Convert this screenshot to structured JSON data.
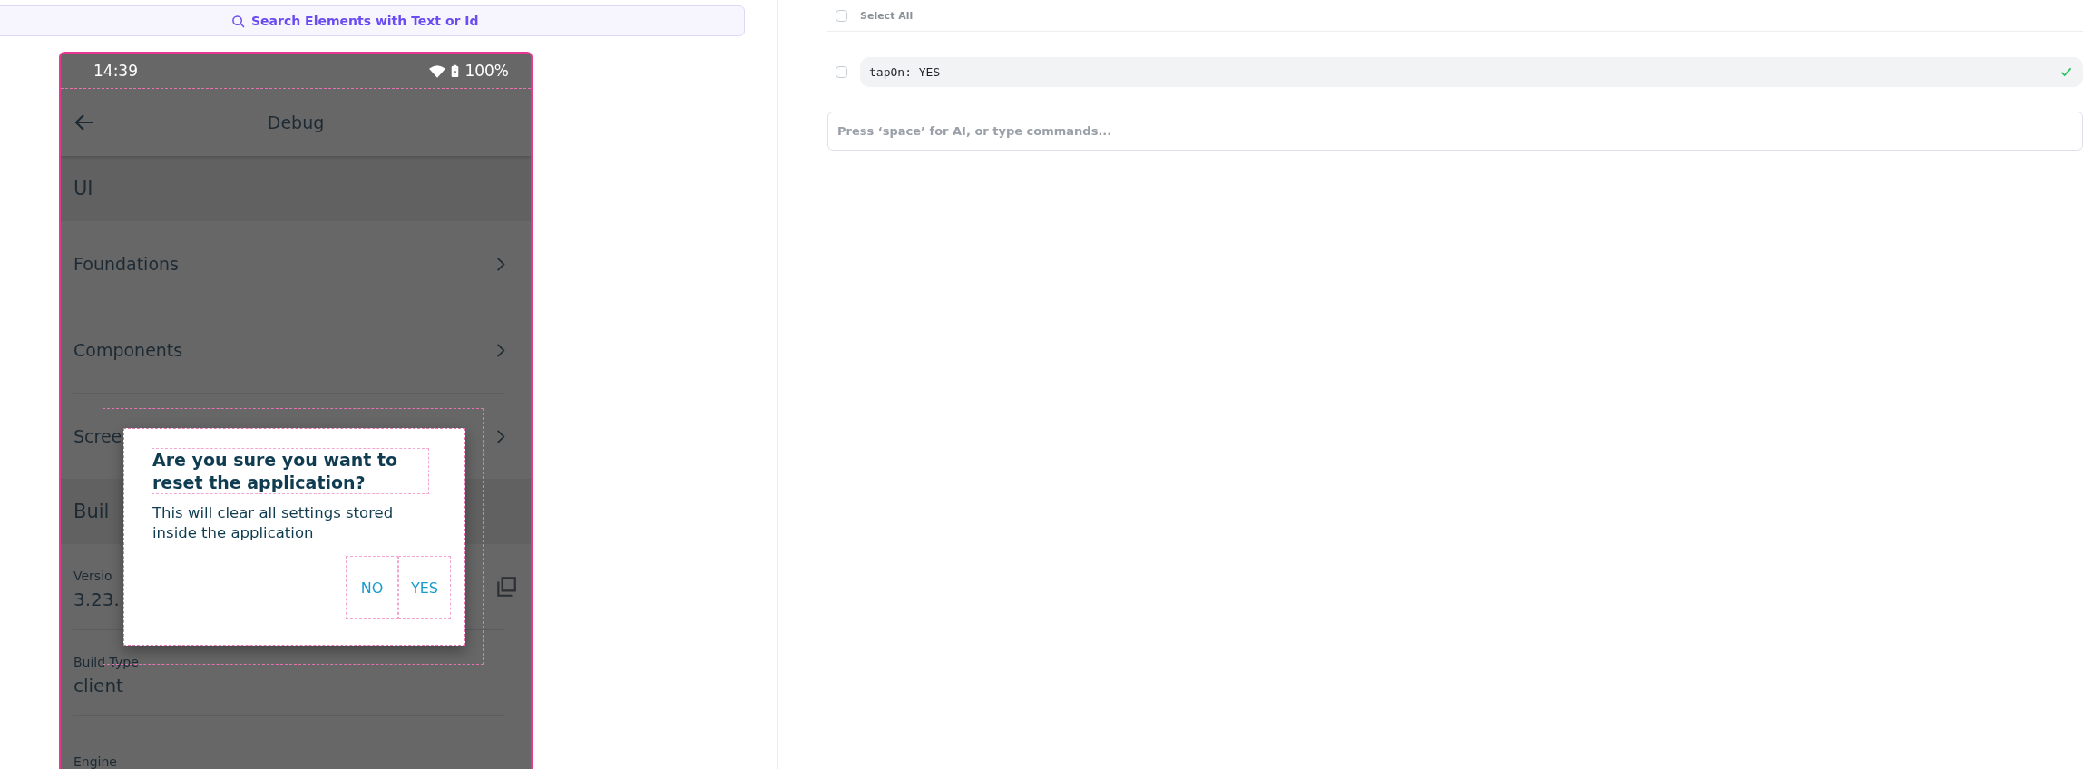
{
  "search": {
    "placeholder": "Search Elements with Text or Id"
  },
  "device": {
    "status_bar": {
      "time": "14:39",
      "battery": "100%"
    },
    "app_bar": {
      "title": "Debug"
    },
    "sections": [
      {
        "header": "UI",
        "rows": [
          {
            "kind": "nav",
            "label": "Foundations"
          },
          {
            "kind": "nav",
            "label": "Components"
          },
          {
            "kind": "nav",
            "label": "Scree"
          }
        ]
      },
      {
        "header": "Buil",
        "rows": [
          {
            "kind": "info",
            "label": "Versio",
            "value": "3.23.",
            "copy": true
          },
          {
            "kind": "info",
            "label": "Build Type",
            "value": "client"
          },
          {
            "kind": "info",
            "label": "Engine"
          }
        ]
      }
    ],
    "dialog": {
      "title": "Are you sure you want to reset the application?",
      "message": "This will clear all settings stored inside the application",
      "buttons": [
        "NO",
        "YES"
      ]
    }
  },
  "commands": {
    "select_all": {
      "label": "Select All",
      "checked": false
    },
    "items": [
      {
        "text": "tapOn: YES",
        "checked": false,
        "passed": true
      }
    ],
    "input": {
      "placeholder": "Press ‘space’ for AI, or type commands..."
    }
  }
}
